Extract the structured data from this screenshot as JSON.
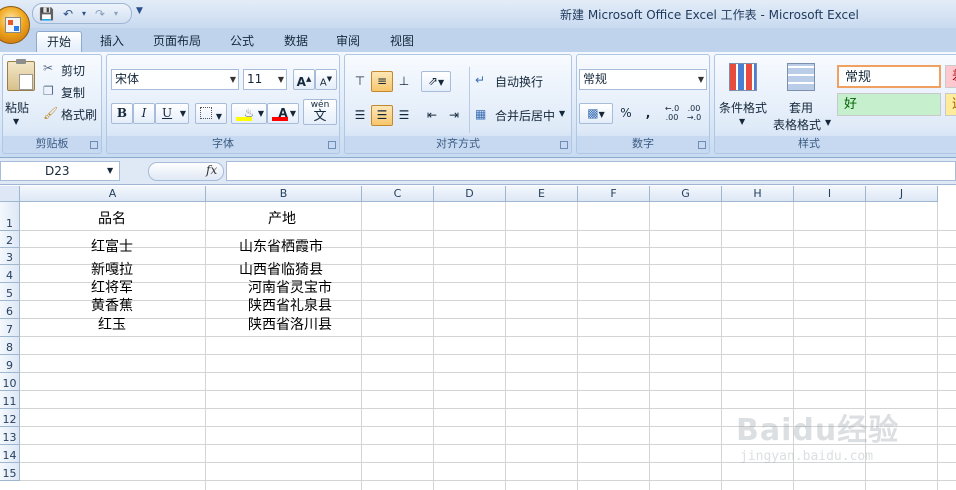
{
  "window": {
    "title": "新建 Microsoft Office Excel 工作表 - Microsoft Excel"
  },
  "tabs": [
    {
      "label": "开始",
      "active": true
    },
    {
      "label": "插入"
    },
    {
      "label": "页面布局"
    },
    {
      "label": "公式"
    },
    {
      "label": "数据"
    },
    {
      "label": "审阅"
    },
    {
      "label": "视图"
    }
  ],
  "ribbon": {
    "clipboard": {
      "paste": "粘贴",
      "cut": "剪切",
      "copy": "复制",
      "format_painter": "格式刷",
      "label": "剪贴板"
    },
    "font": {
      "font_name": "宋体",
      "font_size": "11",
      "bold": "B",
      "italic": "I",
      "underline": "U",
      "wen": "wén",
      "label": "字体"
    },
    "alignment": {
      "wrap_text": "自动换行",
      "merge_center": "合并后居中",
      "label": "对齐方式"
    },
    "number": {
      "format": "常规",
      "percent": "%",
      "comma": ",",
      "label": "数字"
    },
    "styles": {
      "conditional": "条件格式",
      "table_format_1": "套用",
      "table_format_2": "表格格式",
      "normal": "常规",
      "good": "好",
      "bad": "差",
      "neutral": "适",
      "label": "样式"
    }
  },
  "formula_bar": {
    "name_box": "D23",
    "fx": "fx",
    "value": ""
  },
  "sheet": {
    "columns": [
      "A",
      "B",
      "C",
      "D",
      "E",
      "F",
      "G",
      "H",
      "I",
      "J"
    ],
    "rows": [
      "1",
      "2",
      "3",
      "4",
      "5",
      "6",
      "7",
      "8",
      "9",
      "10",
      "11",
      "12",
      "13",
      "14",
      "15"
    ],
    "cells": {
      "A1": "品名",
      "B1": "产地",
      "A2": "红富士",
      "B2": "山东省栖霞市",
      "A3": "新嘎拉",
      "B3": "山西省临猗县",
      "A4": "红将军",
      "B4": "河南省灵宝市",
      "A5": "黄香蕉",
      "B5": "陕西省礼泉县",
      "A6": "红玉",
      "B6": "陕西省洛川县"
    }
  },
  "watermark": {
    "text": "Baidu经验",
    "sub": "jingyan.baidu.com"
  }
}
